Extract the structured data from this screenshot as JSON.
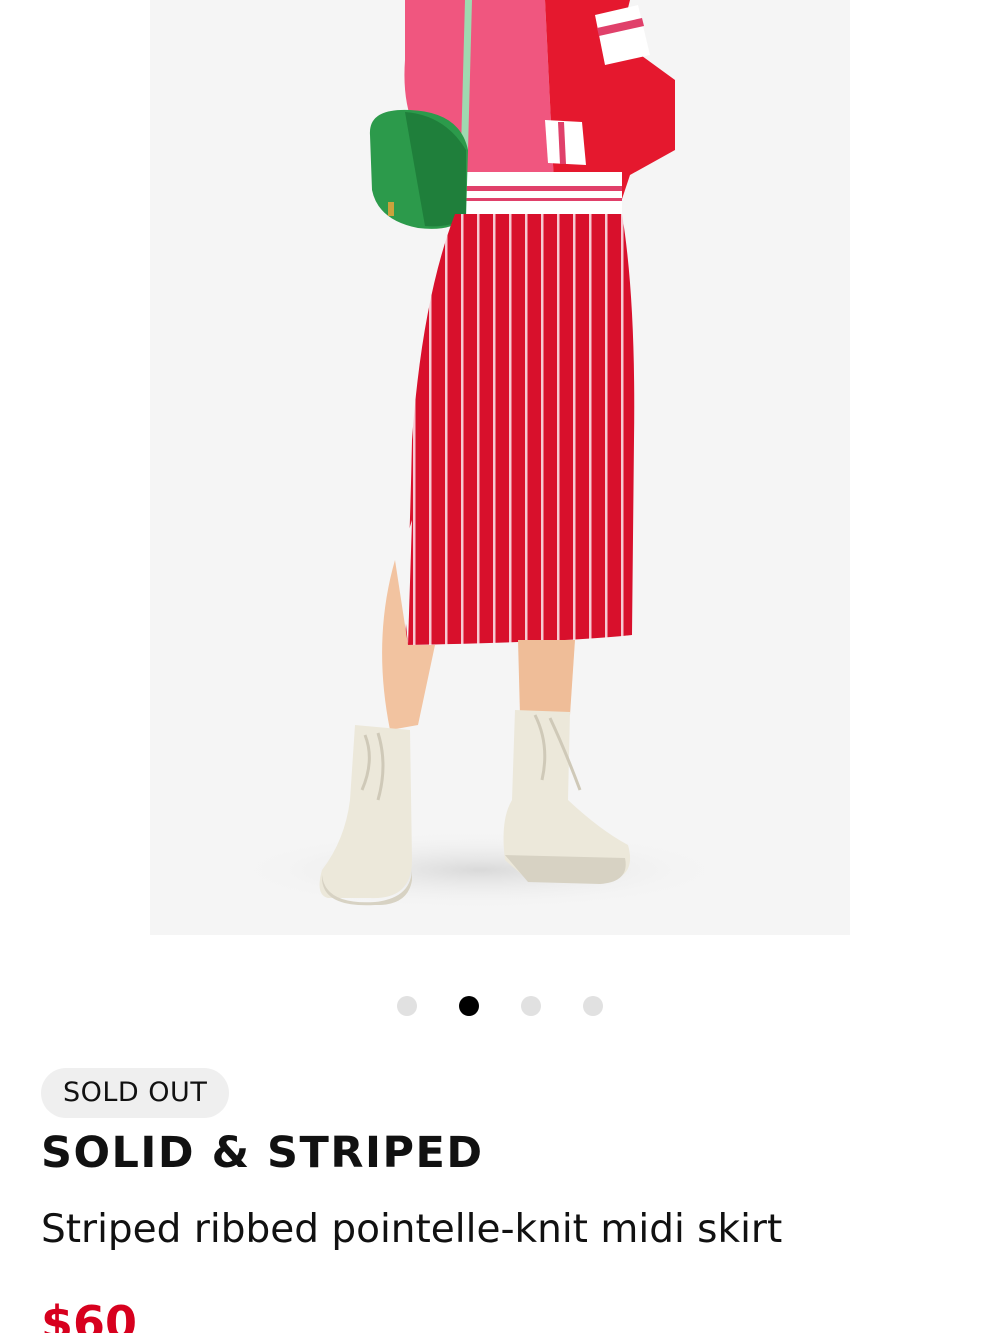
{
  "product": {
    "badge": "SOLD OUT",
    "brand": "SOLID & STRIPED",
    "name": "Striped ribbed pointelle-knit midi skirt",
    "price": "$60"
  },
  "carousel": {
    "image_count": 4,
    "active_index": 1,
    "image_icon": "product-photo-model-skirt"
  },
  "colors": {
    "price": "#d7001e",
    "badge_bg": "#efefef",
    "active_dot": "#000000",
    "inactive_dot": "#e1e1e1",
    "image_bg": "#f5f5f5"
  }
}
